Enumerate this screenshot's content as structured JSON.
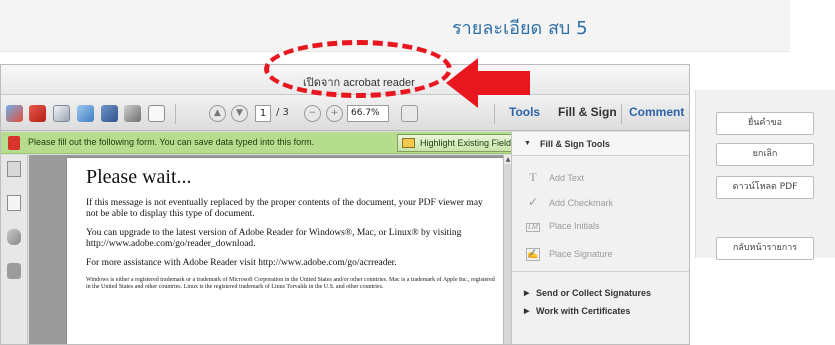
{
  "page": {
    "title": "รายละเอียด สบ 5"
  },
  "window": {
    "title": "เปิดจาก acrobat reader"
  },
  "toolbar": {
    "icons": [
      "create-pdf-icon",
      "open-icon",
      "edit-icon",
      "share-icon",
      "save-icon",
      "print-icon",
      "email-icon"
    ],
    "page_current": "1",
    "page_total": "/ 3",
    "zoom": "66.7%",
    "tools_label": "Tools",
    "fill_sign_label": "Fill & Sign",
    "comment_label": "Comment",
    "link_color": "#2d63a8"
  },
  "form_bar": {
    "message": "Please fill out the following form. You can save data typed into this form.",
    "highlight_button": "Highlight Existing Fields",
    "bar_color": "#b6dd8d"
  },
  "document": {
    "heading": "Please wait...",
    "para1": "If this message is not eventually replaced by the proper contents of the document, your PDF viewer may not be able to display this type of document.",
    "para2": "You can upgrade to the latest version of Adobe Reader for Windows®, Mac, or Linux® by visiting  http://www.adobe.com/go/reader_download.",
    "para3": "For more assistance with Adobe Reader visit  http://www.adobe.com/go/acrreader.",
    "legal": "Windows is either a registered trademark or a trademark of Microsoft Corporation in the United States and/or other countries. Mac is a trademark of Apple Inc., registered in the United States and other countries. Linux is the registered trademark of Linus Torvalds in the U.S. and other countries."
  },
  "right_pane": {
    "header": "Fill & Sign Tools",
    "tools": [
      {
        "label": "Add Text",
        "glyph": "T",
        "icon": "text-tool-icon"
      },
      {
        "label": "Add Checkmark",
        "glyph": "✓",
        "icon": "checkmark-tool-icon"
      },
      {
        "label": "Place Initials",
        "glyph": "LM",
        "icon": "initials-tool-icon"
      },
      {
        "label": "Place Signature",
        "glyph": "✍",
        "icon": "signature-tool-icon"
      }
    ],
    "send_collect": "Send or Collect Signatures",
    "certificates": "Work with Certificates"
  },
  "actions": {
    "submit": "ยื่นคำขอ",
    "cancel": "ยกเลิก",
    "download": "ดาวน์โหลด PDF",
    "back": "กลับหน้ารายการ"
  },
  "annotation_color": "#e8171f"
}
